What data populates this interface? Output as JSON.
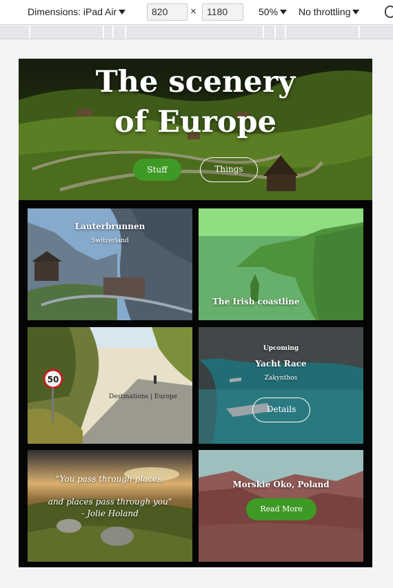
{
  "devtools": {
    "device_label": "Dimensions: iPad Air",
    "width_value": "820",
    "times_symbol": "×",
    "height_value": "1180",
    "zoom": "50%",
    "throttling": "No throttling"
  },
  "hero": {
    "title_line1": "The scenery",
    "title_line2": "of Europe",
    "buttons": {
      "stuff": "Stuff",
      "things": "Things"
    }
  },
  "cards": {
    "lauterbrunnen": {
      "title": "Lauterbrunnen",
      "subtitle": "Switzerland"
    },
    "irish": {
      "title": "The Irish coastline"
    },
    "road": {
      "caption": "Destinations | Europe"
    },
    "yacht": {
      "eyebrow": "Upcoming",
      "title": "Yacht Race",
      "location": "Zakynthos",
      "button": "Details"
    },
    "quote": {
      "line1": "\"You pass through places,",
      "line2": "and places pass through you\"",
      "author": "- Jolie Holand"
    },
    "morskie": {
      "title": "Morskie Oko, Poland",
      "button": "Read More"
    }
  },
  "icons": [
    "device-dropdown-caret",
    "zoom-dropdown-caret",
    "throttling-dropdown-caret",
    "rotate-icon",
    "speed-limit-sign-icon"
  ],
  "colors": {
    "accent_green": "#3e9a25",
    "page_bg": "#050505",
    "toolbar_bg": "#ffffff",
    "ruler_bg": "#e4e6ea"
  }
}
